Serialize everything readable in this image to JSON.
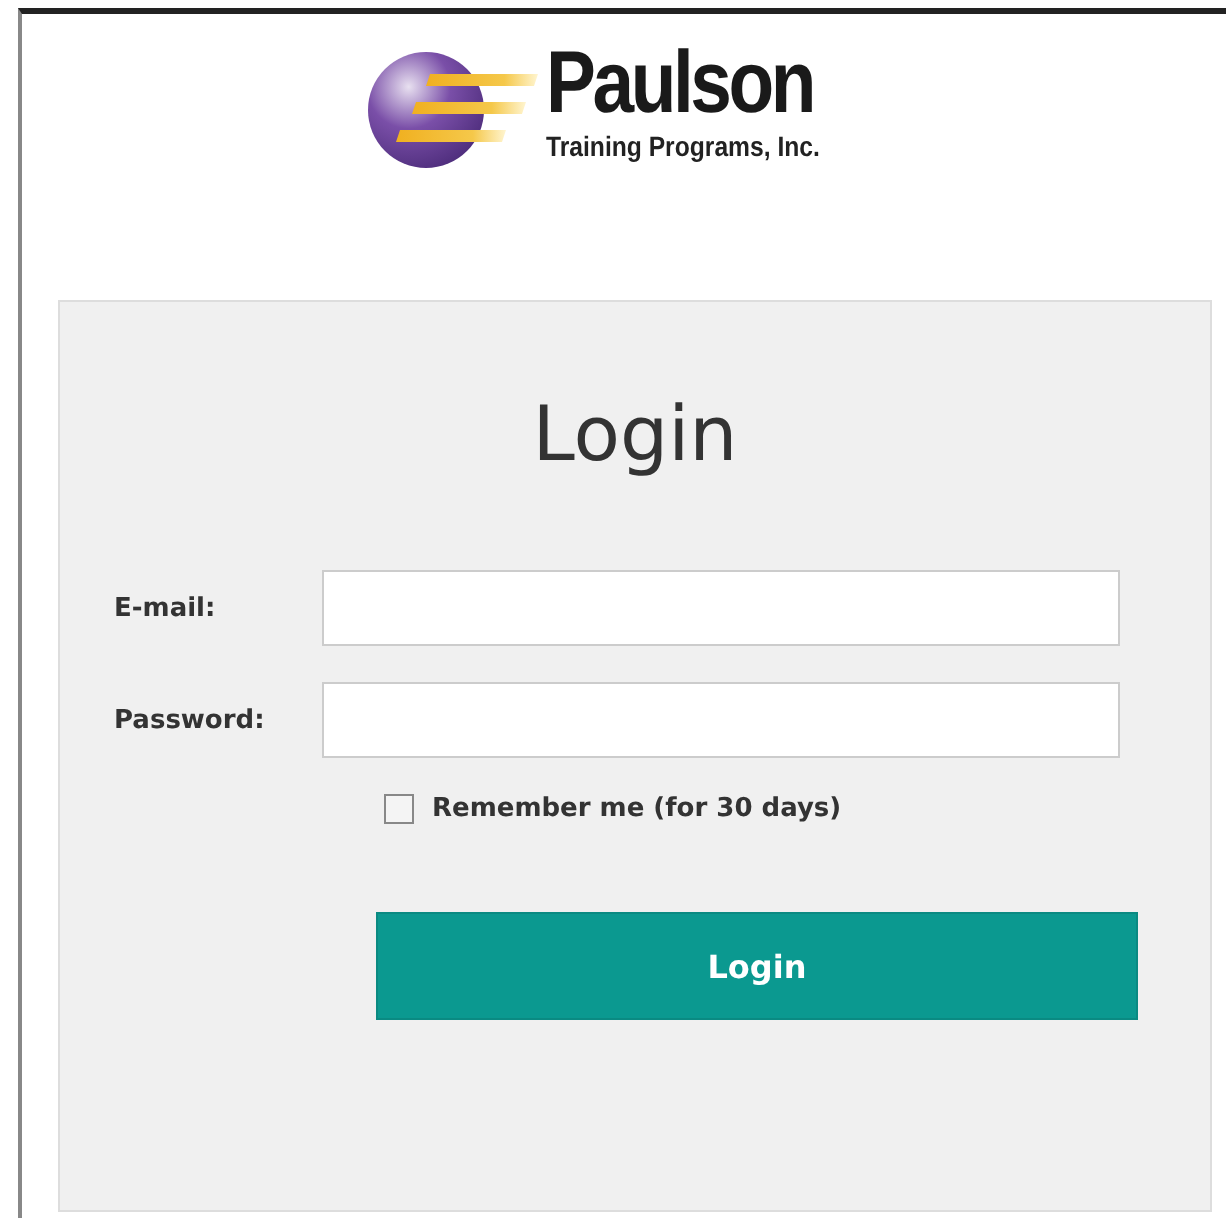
{
  "logo": {
    "name": "Paulson",
    "tagline": "Training Programs, Inc."
  },
  "form": {
    "title": "Login",
    "fields": [
      {
        "label": "E-mail:"
      },
      {
        "label": "Password:"
      }
    ],
    "remember": {
      "label": "Remember me (for 30 days)",
      "checked": false
    },
    "submit": "Login"
  }
}
